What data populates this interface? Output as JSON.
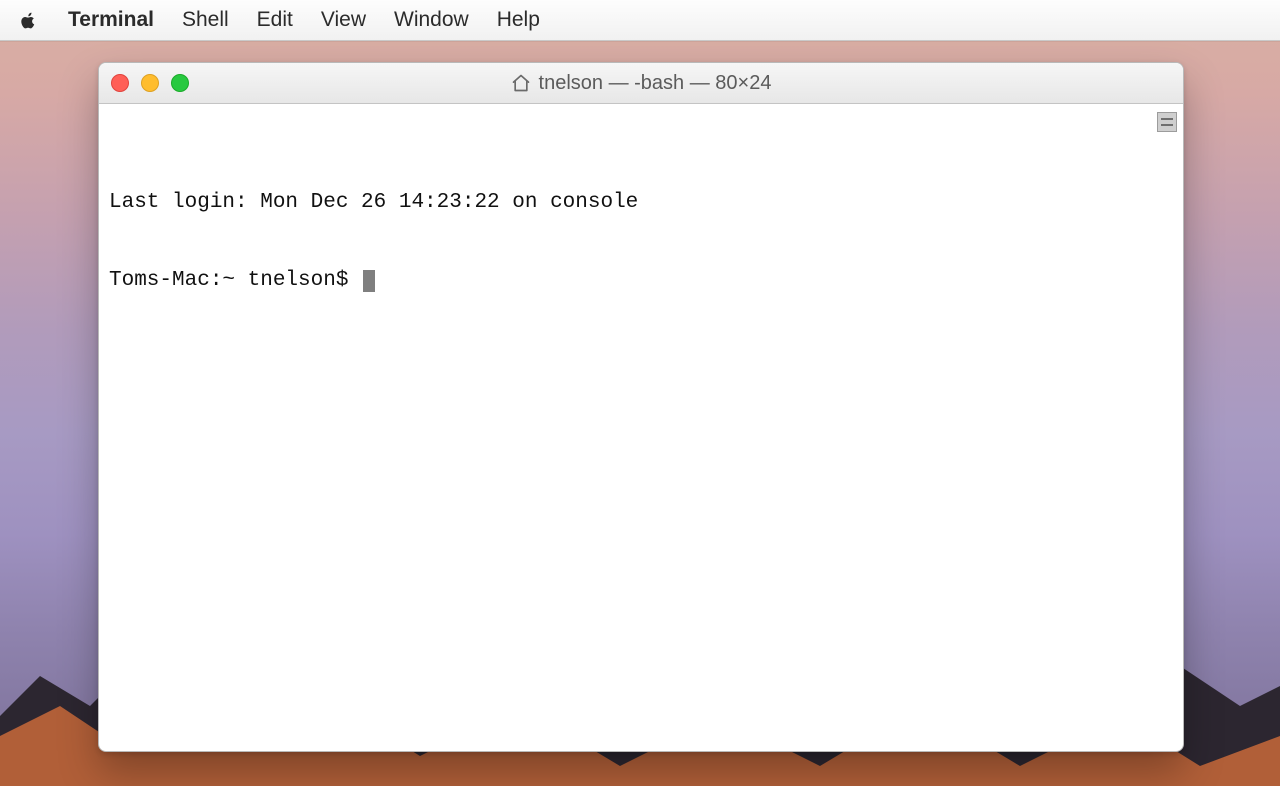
{
  "menubar": {
    "app_name": "Terminal",
    "items": [
      "Shell",
      "Edit",
      "View",
      "Window",
      "Help"
    ]
  },
  "window": {
    "title": "tnelson — -bash — 80×24"
  },
  "terminal": {
    "last_login_line": "Last login: Mon Dec 26 14:23:22 on console",
    "prompt": "Toms-Mac:~ tnelson$"
  }
}
